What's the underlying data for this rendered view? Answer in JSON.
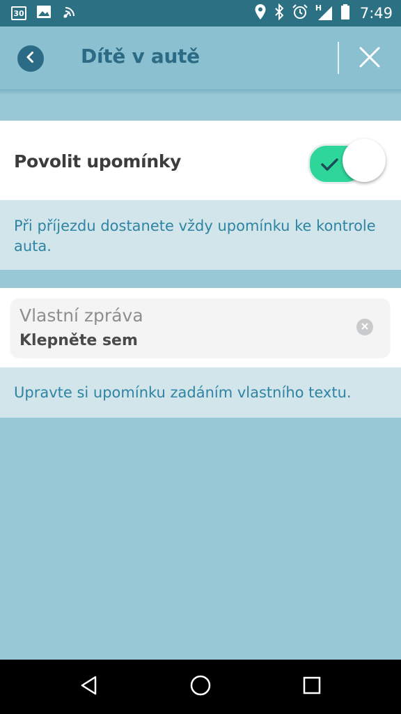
{
  "status_bar": {
    "calendar_day": "30",
    "time": "7:49",
    "network_type": "H",
    "icons": [
      "calendar-icon",
      "image-icon",
      "nfc-icon",
      "location-icon",
      "bluetooth-icon",
      "alarm-icon",
      "signal-icon",
      "battery-icon"
    ]
  },
  "header": {
    "title": "Dítě v autě",
    "back_icon": "chevron-left-icon",
    "close_icon": "close-icon"
  },
  "reminder": {
    "label": "Povolit upomínky",
    "enabled": true,
    "description": "Při příjezdu dostanete vždy upomínku ke kontrole auta."
  },
  "custom_message": {
    "label": "Vlastní zpráva",
    "value": "Klepněte sem",
    "description": "Upravte si upomínku zadáním vlastního textu."
  },
  "nav_bar": {
    "icons": [
      "back-triangle-icon",
      "home-circle-icon",
      "recents-square-icon"
    ]
  },
  "colors": {
    "status_bar": "#2c7083",
    "app_bar": "#8bc0d0",
    "background": "#98c8d6",
    "accent": "#2c6b85",
    "toggle_on": "#2fd69a",
    "info_text": "#2f84a2"
  }
}
